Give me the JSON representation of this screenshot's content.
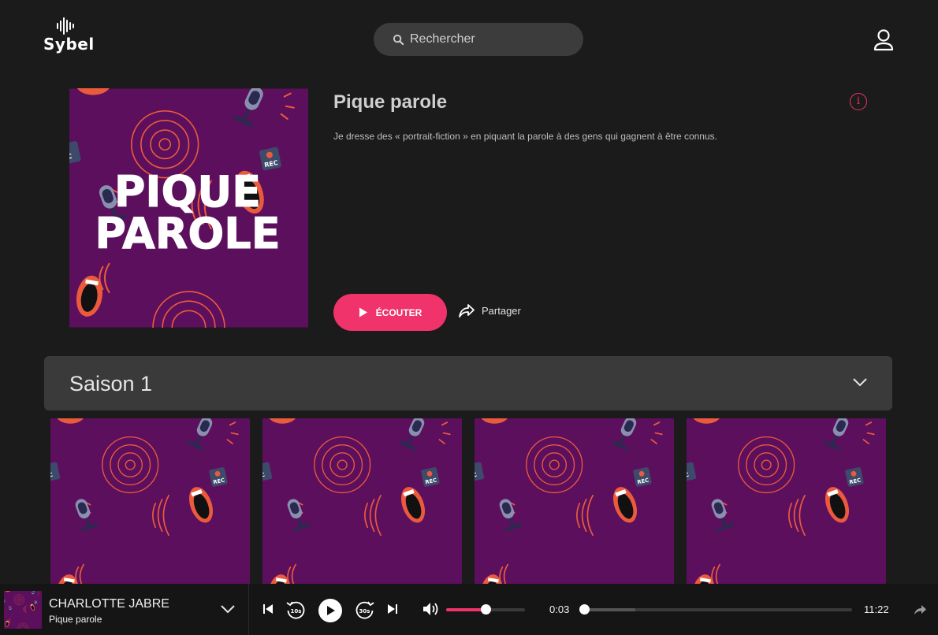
{
  "brand": {
    "name": "Sybel"
  },
  "header": {
    "search_placeholder": "Rechercher"
  },
  "show": {
    "title": "Pique parole",
    "description": "Je dresse des « portrait-fiction » en piquant la parole à des gens qui gagnent à être connus.",
    "cover_text_line1": "PIQUE",
    "cover_text_line2": "PAROLE",
    "listen_label": "ÉCOUTER",
    "share_label": "Partager",
    "info_symbol": "i"
  },
  "season": {
    "label": "Saison 1"
  },
  "episodes": [
    {},
    {},
    {},
    {}
  ],
  "player": {
    "artist": "CHARLOTTE JABRE",
    "show": "Pique parole",
    "rewind_label": "10s",
    "forward_label": "30s",
    "elapsed": "0:03",
    "duration": "11:22",
    "volume": 0.5,
    "progress": 0.004
  },
  "colors": {
    "accent": "#f0336a",
    "cover_bg": "#5c0f5c",
    "pattern": "#ea5a3d",
    "background": "#1b1b1b"
  }
}
